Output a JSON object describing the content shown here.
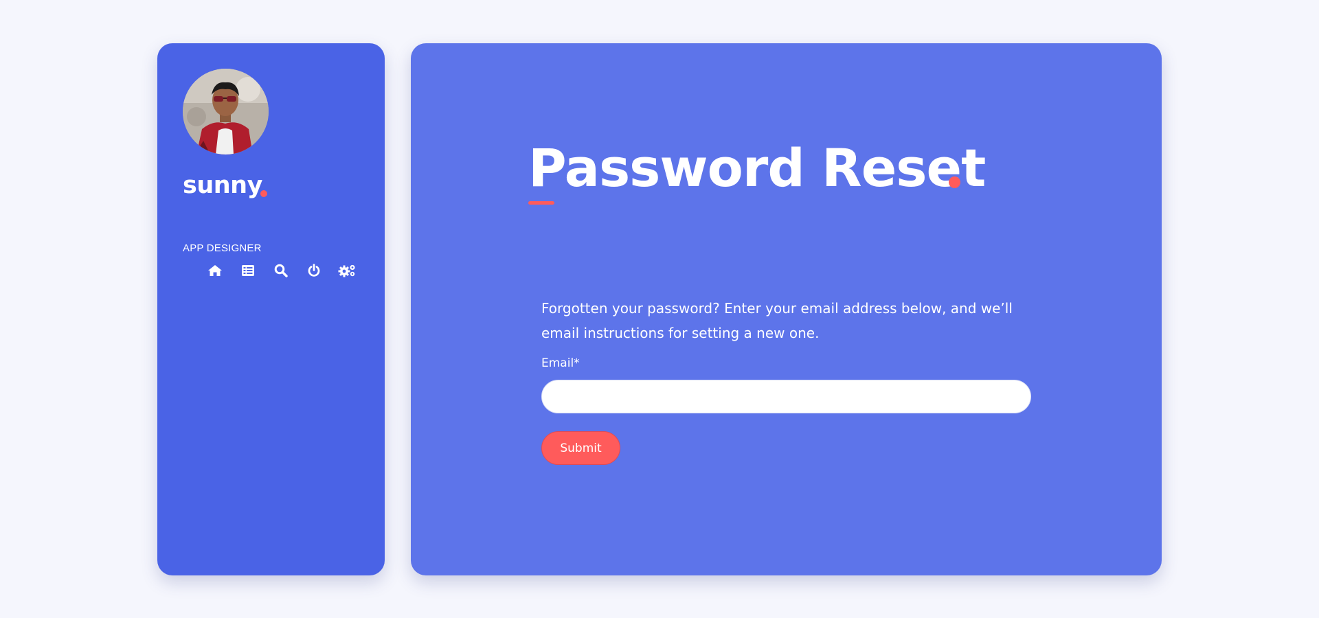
{
  "profile": {
    "name": "sunny",
    "role": "APP DESIGNER",
    "avatar_alt": "profile photo"
  },
  "nav": {
    "items": [
      {
        "icon": "home-icon"
      },
      {
        "icon": "list-icon"
      },
      {
        "icon": "search-icon"
      },
      {
        "icon": "power-icon"
      },
      {
        "icon": "settings-icon"
      }
    ]
  },
  "main": {
    "title": "Password Reset",
    "instructions": "Forgotten your password? Enter your email address below, and we’ll email instructions for setting a new one.",
    "email_label": "Email*",
    "email_value": "",
    "submit_label": "Submit"
  },
  "colors": {
    "background": "#f5f6fd",
    "sidebar": "#4a63e6",
    "main_panel": "#5d74ea",
    "accent": "#ff5b5b",
    "text": "#ffffff"
  }
}
